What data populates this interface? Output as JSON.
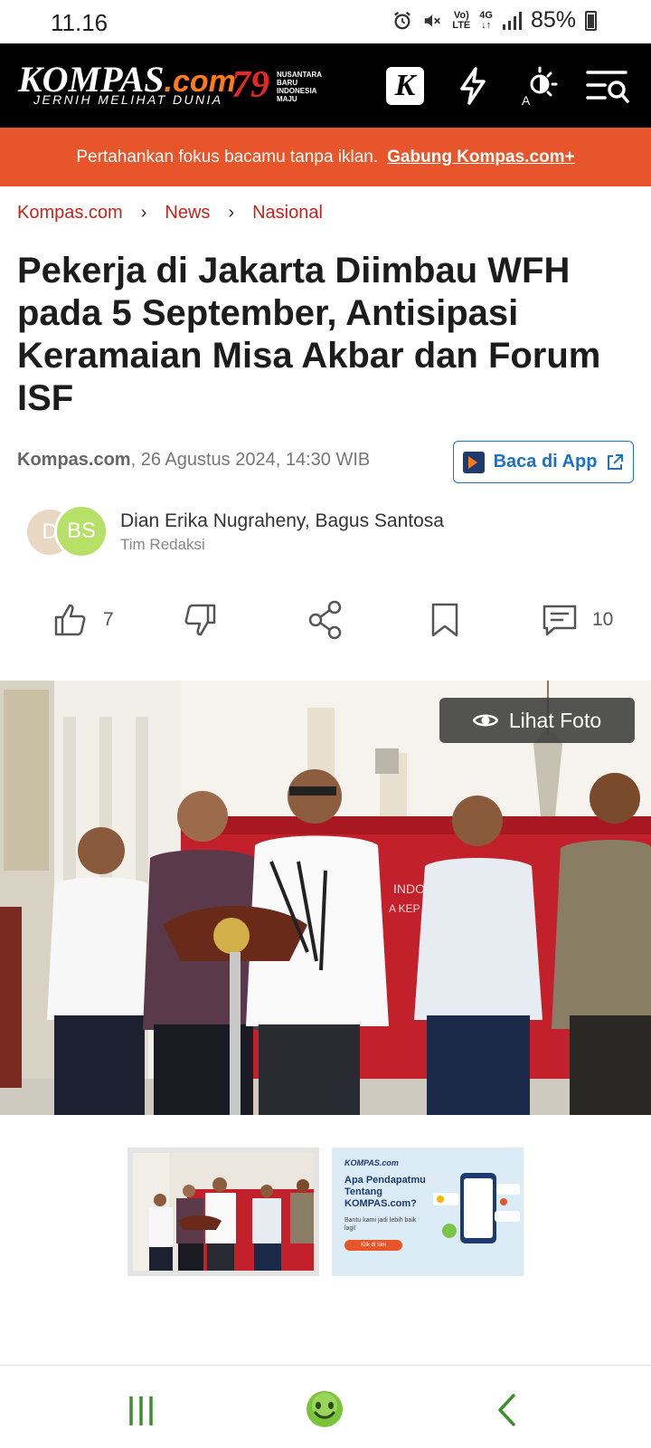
{
  "status_bar": {
    "time": "11.16",
    "volte_label_top": "Vo)",
    "volte_label_bottom": "LTE",
    "network_top": "4G",
    "network_bottom": "↓↑",
    "battery": "85%"
  },
  "header": {
    "logo_text": "KOMPAS",
    "logo_suffix": ".com",
    "tagline": "JERNIH MELIHAT DUNIA",
    "anniversary_number": "79",
    "anniversary_lines": [
      "NUSANTARA",
      "BARU",
      "INDONESIA",
      "MAJU"
    ],
    "k_badge_letter": "K",
    "font_size_letter": "A",
    "accent_color": "#e8552a",
    "brand_orange": "#ff7a1a"
  },
  "promo": {
    "text": "Pertahankan fokus bacamu tanpa iklan.",
    "link": "Gabung Kompas.com+"
  },
  "breadcrumb": [
    "Kompas.com",
    "News",
    "Nasional"
  ],
  "article": {
    "title": "Pekerja di Jakarta Diimbau WFH pada 5 September, Antisipasi Keramaian Misa Akbar dan Forum ISF",
    "source": "Kompas.com",
    "date": ", 26 Agustus 2024, 14:30 WIB",
    "app_button": "Baca di App",
    "authors": {
      "initials": [
        "D",
        "BS"
      ],
      "names": "Dian Erika Nugraheny, Bagus Santosa",
      "team": "Tim Redaksi"
    }
  },
  "actions": {
    "like_count": "7",
    "comment_count": "10"
  },
  "photo": {
    "lihat_foto": "Lihat Foto",
    "backdrop_text": "INDO",
    "backdrop_text_2": "A KEP"
  },
  "ad": {
    "brand": "KOMPAS.com",
    "headline": "Apa Pendapatmu Tentang KOMPAS.com?",
    "sub": "Bantu kami jadi lebih baik lagi!",
    "cta": "Klik di Sini"
  },
  "colors": {
    "breadcrumb": "#c8221a",
    "link_blue": "#1a73c8",
    "nav_green": "#3d8f2e"
  }
}
